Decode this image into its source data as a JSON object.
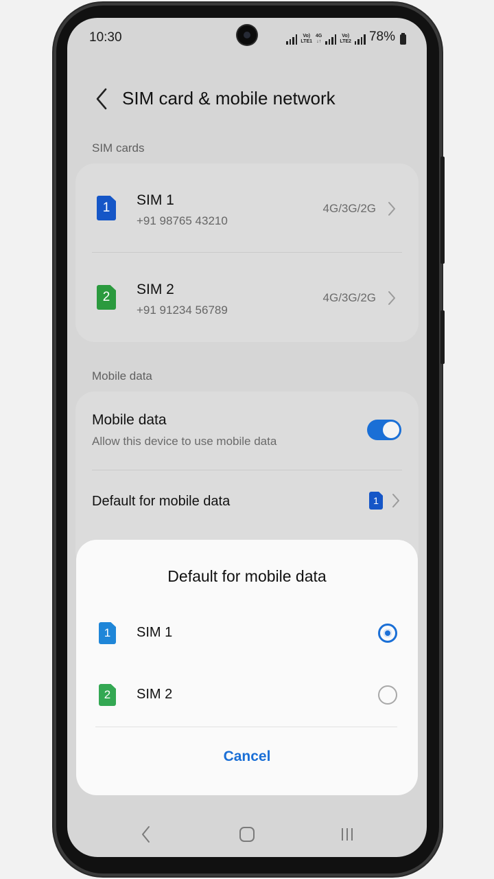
{
  "status_bar": {
    "time": "10:30",
    "battery": "78%",
    "sim1_tag": [
      "Vo)",
      "LTE1"
    ],
    "net_tag": [
      "4G",
      "↓↑"
    ],
    "sim2_tag": [
      "Vo)",
      "LTE2"
    ]
  },
  "header": {
    "title": "SIM card & mobile network",
    "back_icon": "chevron-left-icon"
  },
  "sim_section": {
    "label": "SIM cards",
    "sims": [
      {
        "badge": "1",
        "name": "SIM 1",
        "number": "+91 98765 43210",
        "network": "4G/3G/2G",
        "color": "#1556c7"
      },
      {
        "badge": "2",
        "name": "SIM 2",
        "number": "+91 91234 56789",
        "network": "4G/3G/2G",
        "color": "#2b9a3e"
      }
    ]
  },
  "data_section": {
    "label": "Mobile data",
    "mobile_data": {
      "title": "Mobile data",
      "subtitle": "Allow this device to use mobile data",
      "enabled": true
    },
    "default": {
      "label": "Default for mobile data",
      "selected_badge": "1"
    }
  },
  "dialog": {
    "title": "Default for mobile data",
    "options": [
      {
        "badge": "1",
        "name": "SIM 1",
        "selected": true,
        "color": "#1f86d8"
      },
      {
        "badge": "2",
        "name": "SIM 2",
        "selected": false,
        "color": "#34a853"
      }
    ],
    "cancel": "Cancel"
  },
  "nav_icons": [
    "back-icon",
    "home-icon",
    "recents-icon"
  ],
  "colors": {
    "accent": "#1a6fd6",
    "screen_bg": "#d6d6d6",
    "dialog_bg": "#fafafa"
  }
}
